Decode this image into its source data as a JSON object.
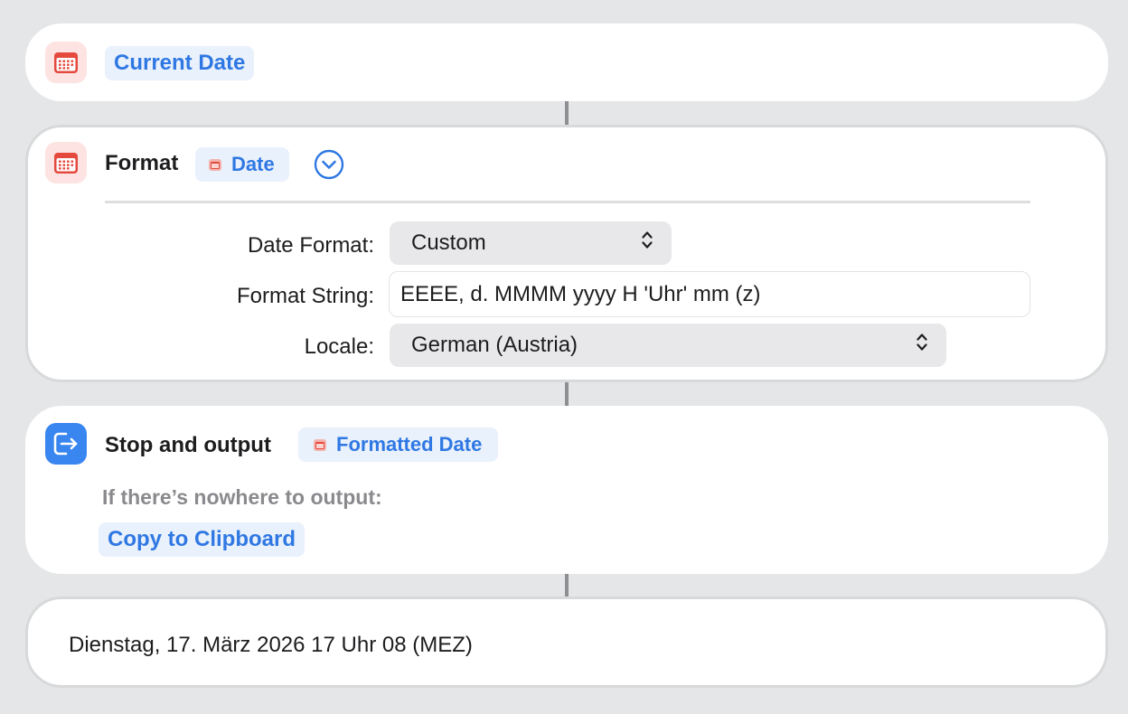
{
  "current_date": {
    "label": "Current Date",
    "icon": "calendar-icon"
  },
  "format_action": {
    "title": "Format",
    "input_token": "Date",
    "icon": "calendar-icon",
    "expand_icon": "chevron-down-circle-icon",
    "fields": {
      "date_format_label": "Date Format:",
      "date_format_value": "Custom",
      "format_string_label": "Format String:",
      "format_string_value": "EEEE, d. MMMM yyyy H 'Uhr' mm (z)",
      "locale_label": "Locale:",
      "locale_value": "German (Austria)"
    }
  },
  "stop_output": {
    "title": "Stop and output",
    "output_token": "Formatted Date",
    "icon": "exit-arrow-icon",
    "fallback_label": "If there’s nowhere to output:",
    "fallback_value": "Copy to Clipboard"
  },
  "result": {
    "text": "Dienstag, 17. März 2026 17 Uhr 08 (MEZ)"
  },
  "colors": {
    "background": "#e4e6e7",
    "card": "#ffffff",
    "accent_blue": "#2f78e3",
    "token_bg": "#e9f1fc",
    "calendar_red": "#e5493e",
    "exit_blue": "#3a86f0",
    "muted_text": "#8a8a8e"
  }
}
